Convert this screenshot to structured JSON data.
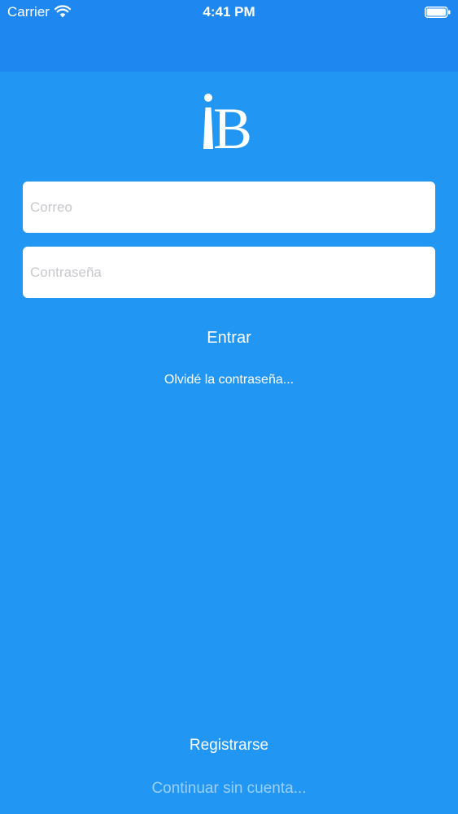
{
  "status_bar": {
    "carrier": "Carrier",
    "time": "4:41 PM",
    "wifi_icon": "wifi-icon",
    "battery_icon": "battery-icon",
    "color": "#1E88F0"
  },
  "logo": {
    "text": "iB",
    "icon": "app-logo"
  },
  "login_form": {
    "email_placeholder": "Correo",
    "email_value": "",
    "password_placeholder": "Contraseña",
    "password_value": "",
    "login_label": "Entrar",
    "forgot_label": "Olvidé la contraseña..."
  },
  "footer": {
    "register_label": "Registrarse",
    "guest_label": "Continuar sin cuenta..."
  },
  "colors": {
    "background": "#2196F3",
    "header": "#1E88F0",
    "input_background": "#FFFFFF",
    "placeholder": "#C7C7CD",
    "text": "#FFFFFF"
  }
}
